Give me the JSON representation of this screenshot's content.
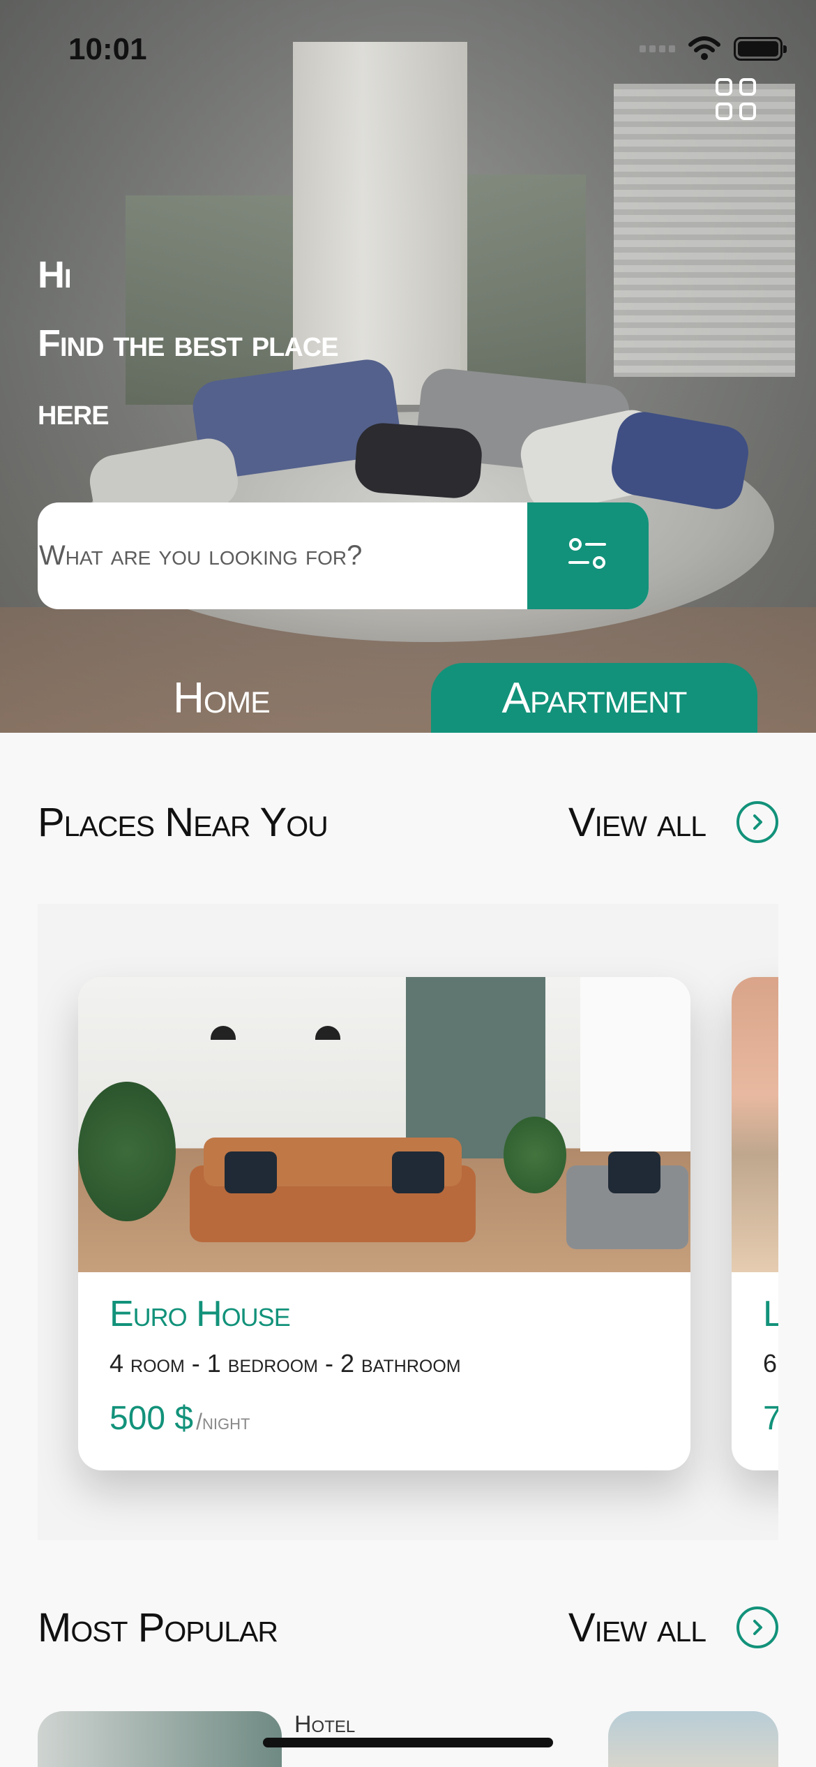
{
  "status_bar": {
    "time": "10:01"
  },
  "header": {
    "menu_icon": "grid-icon",
    "greeting_lines": [
      "Hi",
      "Find the best place",
      "here"
    ]
  },
  "search": {
    "placeholder": "What are you looking for?",
    "filter_icon": "filter-icon"
  },
  "tabs": [
    {
      "label": "Home",
      "active": false
    },
    {
      "label": "Apartment",
      "active": true
    }
  ],
  "places_near_you": {
    "title": "Places Near You",
    "view_all_label": "View all",
    "cards": [
      {
        "title": "Euro House",
        "specs": "4 room - 1 bedroom - 2 bathroom",
        "price": "500 $",
        "unit": "/night"
      },
      {
        "title": "L",
        "specs": "6",
        "price": "7"
      }
    ]
  },
  "most_popular": {
    "title": "Most Popular",
    "view_all_label": "View all",
    "partial_label": "Hotel"
  },
  "colors": {
    "accent": "#12927a"
  }
}
